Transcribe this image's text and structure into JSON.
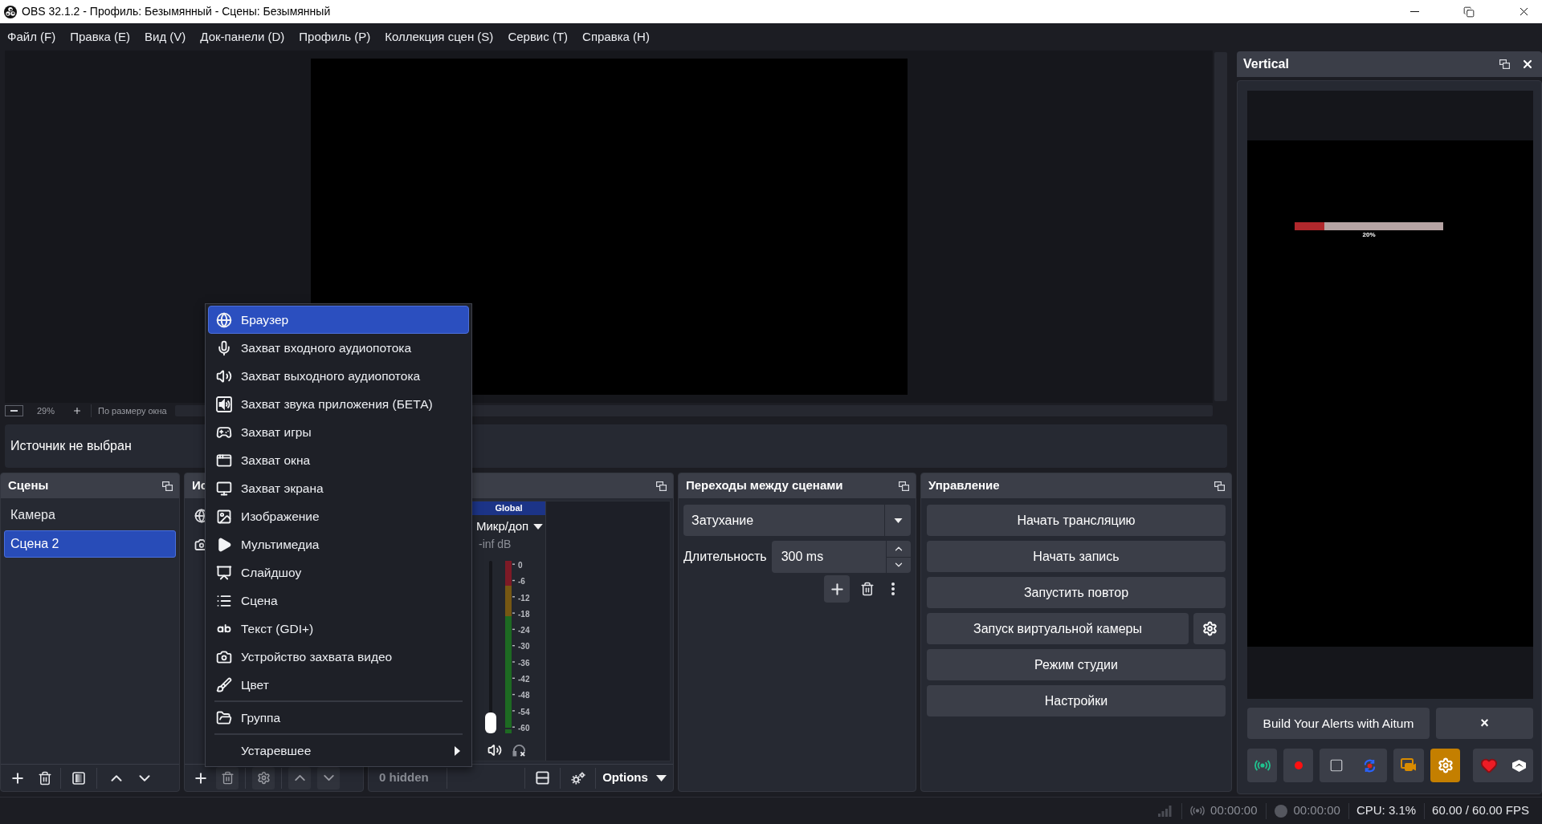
{
  "window": {
    "title": "OBS 32.1.2 - Профиль: Безымянный - Сцены: Безымянный"
  },
  "menu_bar": [
    "Файл (F)",
    "Правка (E)",
    "Вид (V)",
    "Док-панели (D)",
    "Профиль (P)",
    "Коллекция сцен (S)",
    "Сервис (T)",
    "Справка (H)"
  ],
  "preview": {
    "zoom": "29%",
    "fit_label": "По размеру окна"
  },
  "source_toolbar": {
    "status": "Источник не выбран"
  },
  "scenes": {
    "title": "Сцены",
    "items": [
      {
        "label": "Камера",
        "selected": false
      },
      {
        "label": "Сцена 2",
        "selected": true
      }
    ]
  },
  "sources": {
    "title": "Ис",
    "items": [
      {
        "kind": "browser"
      },
      {
        "kind": "camera"
      }
    ]
  },
  "mixer": {
    "channels": [
      {
        "header": "Global",
        "name": "Микр/доп",
        "reading": "-inf dB",
        "level": 0,
        "scale": [
          "0",
          "-6",
          "-12",
          "-18",
          "-24",
          "-30",
          "-36",
          "-42",
          "-48",
          "-54",
          "-60"
        ]
      }
    ],
    "hidden_label": "0 hidden",
    "options_label": "Options"
  },
  "transitions": {
    "title": "Переходы между сценами",
    "transition": "Затухание",
    "duration_label": "Длительность",
    "duration": "300 ms"
  },
  "controls": {
    "title": "Управление",
    "buttons": [
      {
        "label": "Начать трансляцию",
        "kind": "plain"
      },
      {
        "label": "Начать запись",
        "kind": "plain"
      },
      {
        "label": "Запустить повтор",
        "kind": "plain"
      },
      {
        "label": "Запуск виртуальной камеры",
        "kind": "with_settings"
      },
      {
        "label": "Режим студии",
        "kind": "plain"
      },
      {
        "label": "Настройки",
        "kind": "plain"
      }
    ]
  },
  "vertical_dock": {
    "title": "Vertical",
    "progress": {
      "level": 0.2,
      "label": "20%"
    },
    "alerts_button": "Build Your Alerts with Aitum",
    "dismiss_button": "×"
  },
  "context_menu": {
    "groups": [
      [
        {
          "label": "Браузер",
          "selected": true,
          "submenu": false
        },
        {
          "label": "Захват входного аудиопотока",
          "selected": false,
          "submenu": false
        },
        {
          "label": "Захват выходного аудиопотока",
          "selected": false,
          "submenu": false
        },
        {
          "label": "Захват звука приложения (БЕТА)",
          "selected": false,
          "submenu": false
        },
        {
          "label": "Захват игры",
          "selected": false,
          "submenu": false
        },
        {
          "label": "Захват окна",
          "selected": false,
          "submenu": false
        },
        {
          "label": "Захват экрана",
          "selected": false,
          "submenu": false
        },
        {
          "label": "Изображение",
          "selected": false,
          "submenu": false
        },
        {
          "label": "Мультимедиа",
          "selected": false,
          "submenu": false
        },
        {
          "label": "Слайдшоу",
          "selected": false,
          "submenu": false
        },
        {
          "label": "Сцена",
          "selected": false,
          "submenu": false
        },
        {
          "label": "Текст (GDI+)",
          "selected": false,
          "submenu": false
        },
        {
          "label": "Устройство захвата видео",
          "selected": false,
          "submenu": false
        },
        {
          "label": "Цвет",
          "selected": false,
          "submenu": false
        }
      ],
      [
        {
          "label": "Группа",
          "selected": false,
          "submenu": false
        }
      ],
      [
        {
          "label": "Устаревшее",
          "selected": false,
          "submenu": true
        }
      ]
    ]
  },
  "status_bar": {
    "stream_time": "00:00:00",
    "record_time": "00:00:00",
    "cpu": "CPU: 3.1%",
    "fps": "60.00 / 60.00 FPS"
  }
}
